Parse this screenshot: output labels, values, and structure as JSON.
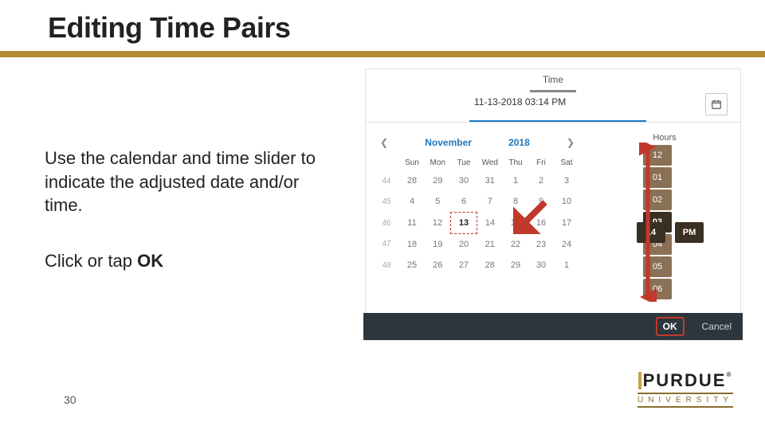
{
  "title": "Editing Time Pairs",
  "body": {
    "paragraph": "Use the calendar and time slider to indicate the adjusted date and/or time.",
    "cta_prefix": "Click or tap ",
    "cta_bold": "OK"
  },
  "page_number": "30",
  "logo": {
    "word": "PURDUE",
    "university": "UNIVERSITY"
  },
  "picker": {
    "tab_label": "Time",
    "field_value": "11-13-2018 03:14 PM",
    "calendar": {
      "month": "November",
      "year": "2018",
      "dow": [
        "Sun",
        "Mon",
        "Tue",
        "Wed",
        "Thu",
        "Fri",
        "Sat"
      ],
      "week_numbers": [
        "44",
        "45",
        "46",
        "47",
        "48"
      ],
      "rows": [
        [
          "28",
          "29",
          "30",
          "31",
          "1",
          "2",
          "3"
        ],
        [
          "4",
          "5",
          "6",
          "7",
          "8",
          "9",
          "10"
        ],
        [
          "11",
          "12",
          "13",
          "14",
          "15",
          "16",
          "17"
        ],
        [
          "18",
          "19",
          "20",
          "21",
          "22",
          "23",
          "24"
        ],
        [
          "25",
          "26",
          "27",
          "28",
          "29",
          "30",
          "1"
        ]
      ],
      "selected_day": "13"
    },
    "hours": {
      "label": "Hours",
      "values": [
        "12",
        "01",
        "02",
        "03",
        "04",
        "05",
        "06"
      ],
      "selected": "03",
      "minute": "14",
      "ampm": "PM"
    },
    "footer": {
      "ok": "OK",
      "cancel": "Cancel"
    }
  }
}
